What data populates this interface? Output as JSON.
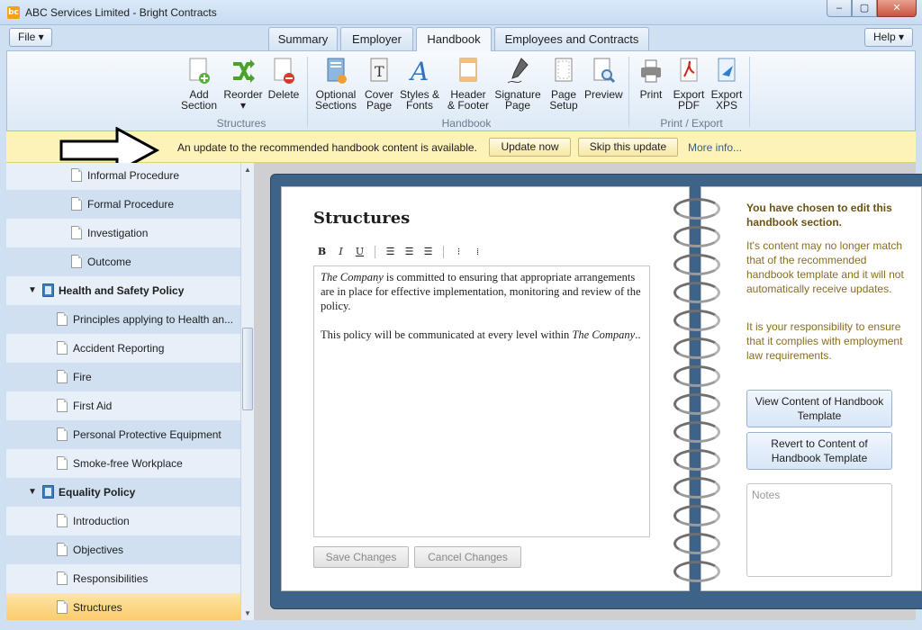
{
  "window": {
    "title": "ABC Services Limited - Bright Contracts",
    "logo_text": "bc",
    "min": "‒",
    "max": "▢",
    "close": "✕"
  },
  "menu": {
    "file": "File ▾",
    "help": "Help ▾"
  },
  "tabs": [
    "Summary",
    "Employer",
    "Handbook",
    "Employees and Contracts"
  ],
  "ribbon": {
    "structures": {
      "label": "Structures",
      "add": "Add Section",
      "reorder": "Reorder ▾",
      "delete": "Delete"
    },
    "handbook": {
      "label": "Handbook",
      "optional": "Optional Sections",
      "cover": "Cover Page",
      "styles": "Styles & Fonts",
      "header": "Header & Footer",
      "signature": "Signature Page",
      "setup": "Page Setup",
      "preview": "Preview"
    },
    "print": {
      "label": "Print / Export",
      "print": "Print",
      "pdf": "Export PDF",
      "xps": "Export XPS"
    }
  },
  "notice": {
    "text": "An update to the recommended handbook content is available.",
    "update": "Update now",
    "skip": "Skip this update",
    "more": "More info..."
  },
  "tree": [
    {
      "label": "Informal Procedure"
    },
    {
      "label": "Formal Procedure"
    },
    {
      "label": "Investigation"
    },
    {
      "label": "Outcome"
    },
    {
      "label": "Health and Safety Policy"
    },
    {
      "label": "Principles applying to Health an..."
    },
    {
      "label": "Accident Reporting"
    },
    {
      "label": "Fire"
    },
    {
      "label": "First Aid"
    },
    {
      "label": "Personal Protective Equipment"
    },
    {
      "label": "Smoke-free Workplace"
    },
    {
      "label": "Equality Policy"
    },
    {
      "label": "Introduction"
    },
    {
      "label": "Objectives"
    },
    {
      "label": "Responsibilities"
    },
    {
      "label": "Structures"
    }
  ],
  "editor": {
    "title": "Structures",
    "p1_em": "The Company",
    "p1_rest": " is committed to ensuring that appropriate arrangements are in place for effective implementation, monitoring and review of the policy.",
    "p2_text": "This policy will be communicated at every level within ",
    "p2_em": "The Company",
    "p2_end": "..",
    "save": "Save Changes",
    "cancel": "Cancel Changes"
  },
  "side": {
    "title": "You have chosen to edit this handbook section.",
    "p1": "It's content may no longer match that of the recommended handbook template and it will not automatically receive updates.",
    "p2": "It is your responsibility to ensure that it complies with employment law requirements.",
    "view": "View Content of Handbook Template",
    "revert": "Revert to Content of Handbook Template",
    "notes_placeholder": "Notes"
  }
}
